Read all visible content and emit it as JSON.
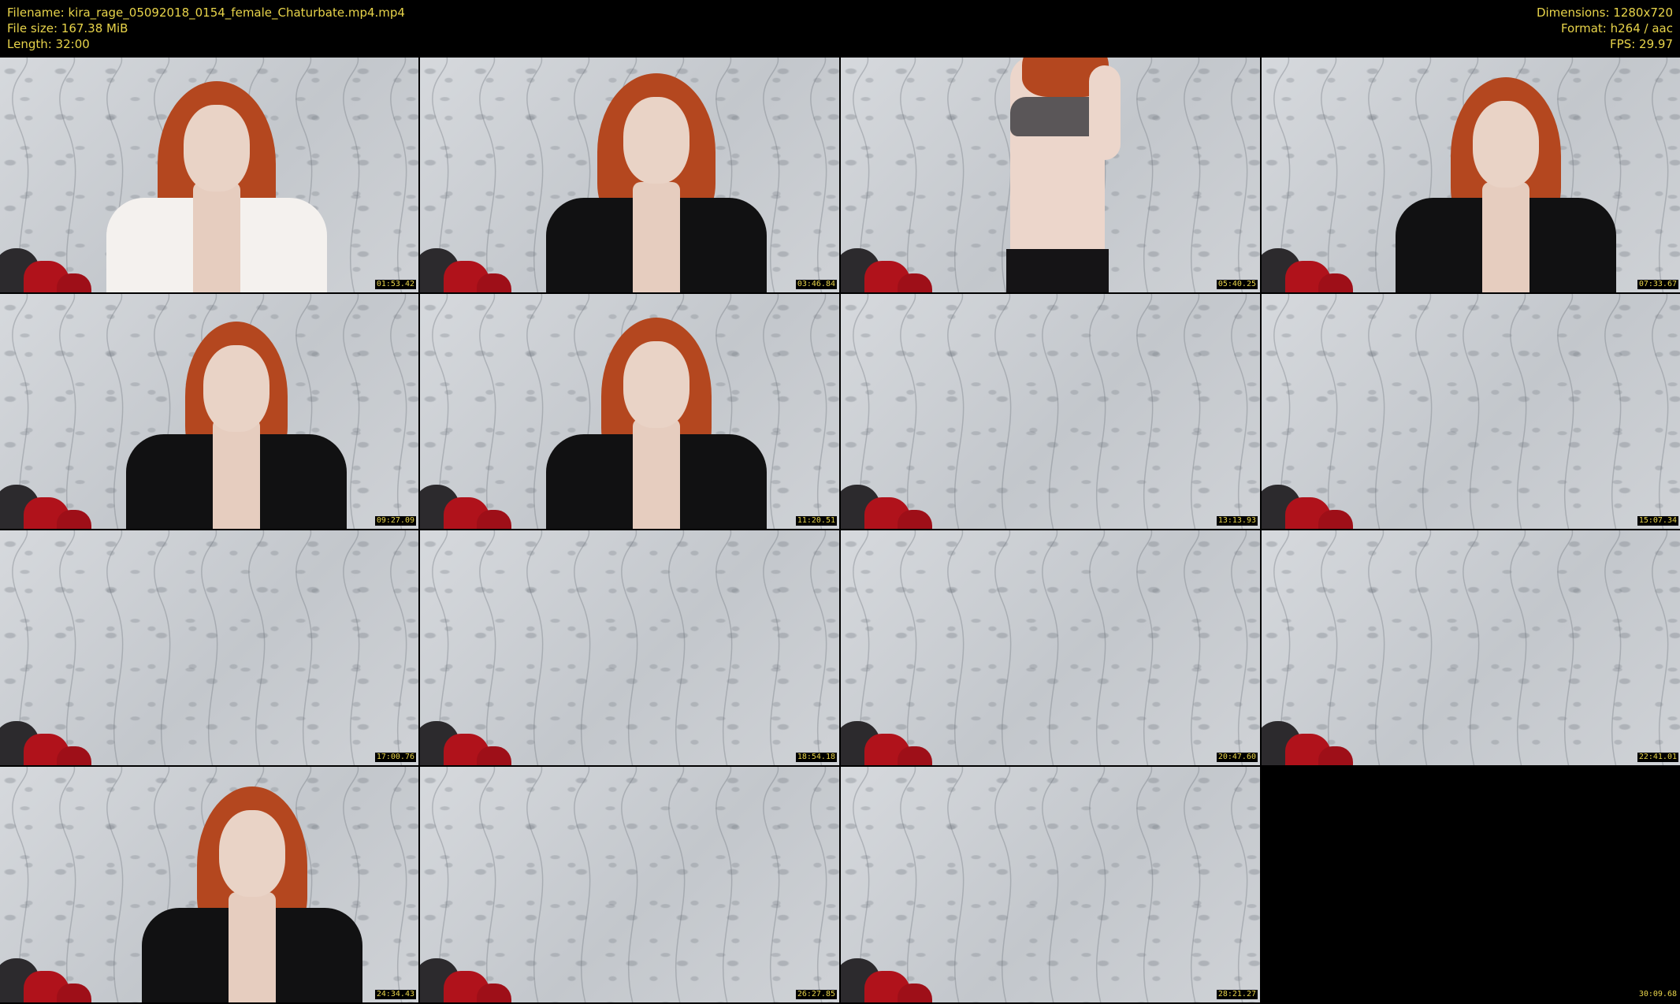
{
  "header": {
    "filename": "Filename: kira_rage_05092018_0154_female_Chaturbate.mp4.mp4",
    "file_size": "File size: 167.38 MiB",
    "length": "Length: 32:00",
    "dimensions": "Dimensions: 1280x720",
    "format": "Format: h264 / aac",
    "fps": "FPS: 29.97"
  },
  "thumbnails": [
    {
      "timestamp": "01:53.42",
      "scene": "person-white-shirt"
    },
    {
      "timestamp": "03:46.84",
      "scene": "person-black-jacket"
    },
    {
      "timestamp": "05:40.25",
      "scene": "person-lingerie"
    },
    {
      "timestamp": "07:33.67",
      "scene": "person-black-jacket"
    },
    {
      "timestamp": "09:27.09",
      "scene": "person-black-jacket"
    },
    {
      "timestamp": "11:20.51",
      "scene": "person-black-jacket"
    },
    {
      "timestamp": "13:13.93",
      "scene": "empty-room"
    },
    {
      "timestamp": "15:07.34",
      "scene": "empty-room"
    },
    {
      "timestamp": "17:00.76",
      "scene": "empty-room"
    },
    {
      "timestamp": "18:54.18",
      "scene": "empty-room"
    },
    {
      "timestamp": "20:47.60",
      "scene": "empty-room"
    },
    {
      "timestamp": "22:41.01",
      "scene": "empty-room"
    },
    {
      "timestamp": "24:34.43",
      "scene": "person-black-jacket"
    },
    {
      "timestamp": "26:27.85",
      "scene": "empty-room"
    },
    {
      "timestamp": "28:21.27",
      "scene": "empty-room"
    },
    {
      "timestamp": "30:09.68",
      "scene": "black-frame"
    }
  ],
  "colors": {
    "background": "#000000",
    "text": "#e8d44a",
    "wallpaper": "#c9ccd0",
    "cushion": "#b0121b",
    "hair": "#b4471f"
  }
}
